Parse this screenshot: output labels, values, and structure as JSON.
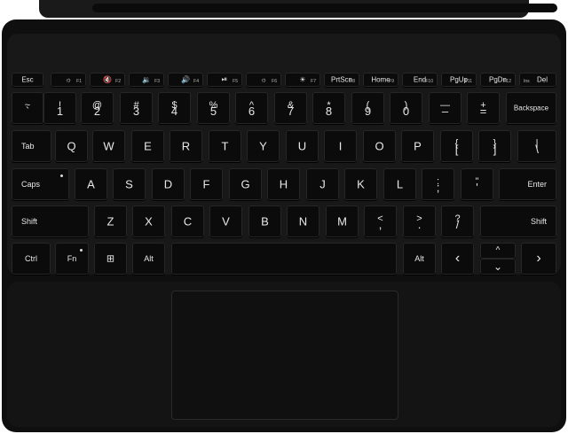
{
  "keyboard": {
    "function_row": [
      {
        "id": "esc",
        "label": "Esc",
        "fn": ""
      },
      {
        "id": "f1",
        "label": "☼",
        "fn": "F1"
      },
      {
        "id": "f2",
        "label": "🔇",
        "fn": "F2"
      },
      {
        "id": "f3",
        "label": "🔉",
        "fn": "F3"
      },
      {
        "id": "f4",
        "label": "🔊",
        "fn": "F4"
      },
      {
        "id": "f5",
        "label": "⏯",
        "fn": "F5"
      },
      {
        "id": "f6",
        "label": "☼",
        "fn": "F6"
      },
      {
        "id": "f7",
        "label": "☀",
        "fn": "F7"
      },
      {
        "id": "f8",
        "label": "PrtScn",
        "fn": "F8"
      },
      {
        "id": "f9",
        "label": "Home",
        "fn": "F9"
      },
      {
        "id": "f10",
        "label": "End",
        "fn": "F10"
      },
      {
        "id": "f11",
        "label": "PgUp",
        "fn": "F11"
      },
      {
        "id": "f12",
        "label": "PgDn",
        "fn": "F12"
      },
      {
        "id": "del",
        "label": "Del",
        "fn": "Ins"
      }
    ],
    "number_row": [
      {
        "id": "tilde",
        "top": "~",
        "bottom": "`"
      },
      {
        "id": "1",
        "top": "!",
        "bottom": "1"
      },
      {
        "id": "2",
        "top": "@",
        "bottom": "2"
      },
      {
        "id": "3",
        "top": "#",
        "bottom": "3"
      },
      {
        "id": "4",
        "top": "$",
        "bottom": "4"
      },
      {
        "id": "5",
        "top": "%",
        "bottom": "5"
      },
      {
        "id": "6",
        "top": "^",
        "bottom": "6"
      },
      {
        "id": "7",
        "top": "&",
        "bottom": "7"
      },
      {
        "id": "8",
        "top": "*",
        "bottom": "8"
      },
      {
        "id": "9",
        "top": "(",
        "bottom": "9"
      },
      {
        "id": "0",
        "top": ")",
        "bottom": "0"
      },
      {
        "id": "minus",
        "top": "—",
        "bottom": "–"
      },
      {
        "id": "equals",
        "top": "+",
        "bottom": "="
      }
    ],
    "backspace": "Backspace",
    "tab": "Tab",
    "qwerty_row": [
      "Q",
      "W",
      "E",
      "R",
      "T",
      "Y",
      "U",
      "I",
      "O",
      "P"
    ],
    "bracket_keys": [
      {
        "id": "lbracket",
        "top": "{",
        "bottom": "["
      },
      {
        "id": "rbracket",
        "top": "}",
        "bottom": "]"
      },
      {
        "id": "backslash",
        "top": "|",
        "bottom": "\\"
      }
    ],
    "caps": "Caps",
    "home_row": [
      "A",
      "S",
      "D",
      "F",
      "G",
      "H",
      "J",
      "K",
      "L"
    ],
    "semicolon": {
      "top": ":",
      "bottom": ";"
    },
    "quote": {
      "top": "\"",
      "bottom": "'"
    },
    "enter": "Enter",
    "shift_left": "Shift",
    "bottom_row_letters": [
      "Z",
      "X",
      "C",
      "V",
      "B",
      "N",
      "M"
    ],
    "comma": {
      "top": "<",
      "bottom": ","
    },
    "period": {
      "top": ">",
      "bottom": "."
    },
    "slash": {
      "top": "?",
      "bottom": "/"
    },
    "shift_right": "Shift",
    "ctrl": "Ctrl",
    "fn_key": "Fn",
    "windows_key": "⊞",
    "alt_left": "Alt",
    "space": "",
    "alt_right": "Alt",
    "arrow_left": "‹",
    "arrow_up": "^",
    "arrow_down": "⌄",
    "arrow_right": "›"
  }
}
